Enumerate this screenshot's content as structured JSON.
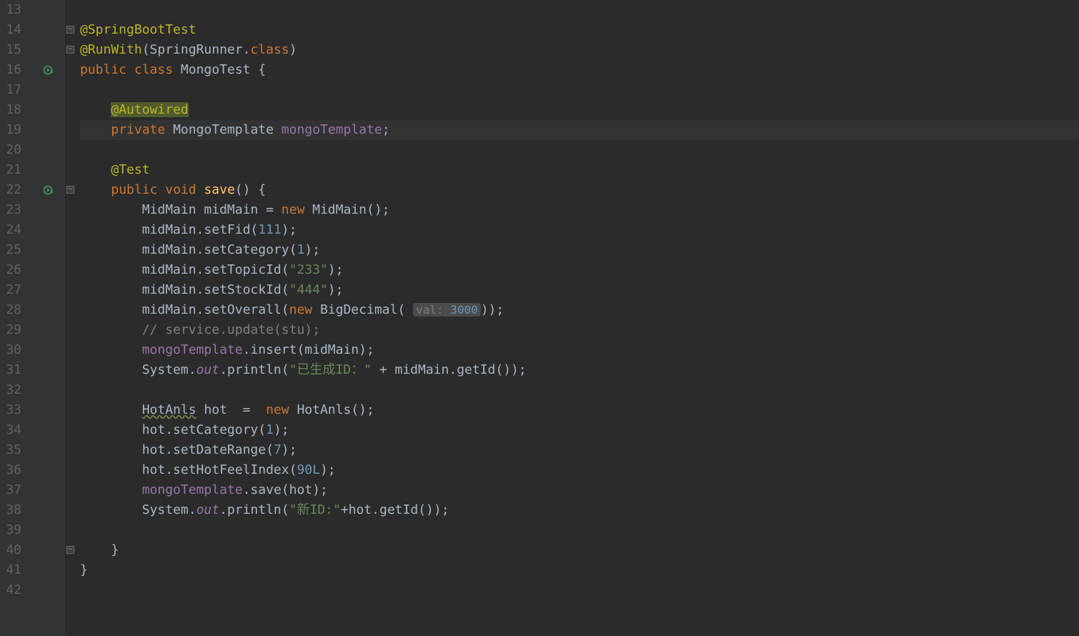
{
  "gutter": {
    "start": 13,
    "end": 42
  },
  "markers": {
    "line16": "run",
    "line22": "run"
  },
  "folds": {
    "line14_top": true,
    "line15_top": true,
    "line22_top": true,
    "line40_bot": true
  },
  "current_line": 19,
  "code": {
    "l14": {
      "anno": "@SpringBootTest"
    },
    "l15": {
      "anno": "@RunWith",
      "p1": "(SpringRunner.",
      "kw": "class",
      "p2": ")"
    },
    "l16": {
      "k1": "public",
      "k2": "class",
      "name": "MongoTest",
      "brace": " {"
    },
    "l18": {
      "anno": "@Autowired"
    },
    "l19": {
      "k1": "private",
      "type": "MongoTemplate",
      "field": "mongoTemplate",
      "semi": ";"
    },
    "l21": {
      "anno": "@Test"
    },
    "l22": {
      "k1": "public",
      "k2": "void",
      "name": "save",
      "rest": "() {"
    },
    "l23": {
      "t1": "MidMain midMain = ",
      "kw": "new",
      "t2": " MidMain();"
    },
    "l24": {
      "t1": "midMain.setFid(",
      "num": "111",
      "t2": ");"
    },
    "l25": {
      "t1": "midMain.setCategory(",
      "num": "1",
      "t2": ");"
    },
    "l26": {
      "t1": "midMain.setTopicId(",
      "str": "\"233\"",
      "t2": ");"
    },
    "l27": {
      "t1": "midMain.setStockId(",
      "str": "\"444\"",
      "t2": ");"
    },
    "l28": {
      "t1": "midMain.setOverall(",
      "kw": "new",
      "t2": " BigDecimal( ",
      "hint_label": "val:",
      "hint_sp": " ",
      "hint_num": "3000",
      "t3": "));"
    },
    "l29": {
      "cmt": "// service.update(stu);"
    },
    "l30": {
      "f": "mongoTemplate",
      "t1": ".insert(midMain);"
    },
    "l31": {
      "t1": "System.",
      "f": "out",
      "t2": ".println(",
      "str": "\"已生成ID：\"",
      "t3": " + midMain.getId());"
    },
    "l33": {
      "warn": "HotAnls",
      "t1": " hot  =  ",
      "kw": "new",
      "t2": " HotAnls();"
    },
    "l34": {
      "t1": "hot.setCategory(",
      "num": "1",
      "t2": ");"
    },
    "l35": {
      "t1": "hot.setDateRange(",
      "num": "7",
      "t2": ");"
    },
    "l36": {
      "t1": "hot.setHotFeelIndex(",
      "num": "90L",
      "t2": ");"
    },
    "l37": {
      "f": "mongoTemplate",
      "t1": ".save(hot);"
    },
    "l38": {
      "t1": "System.",
      "f": "out",
      "t2": ".println(",
      "str": "\"新ID:\"",
      "t3": "+hot.getId());"
    },
    "l40": {
      "brace": "}"
    },
    "l41": {
      "brace": "}"
    }
  },
  "indent": {
    "i0": "",
    "i1": "    ",
    "i2": "        "
  }
}
